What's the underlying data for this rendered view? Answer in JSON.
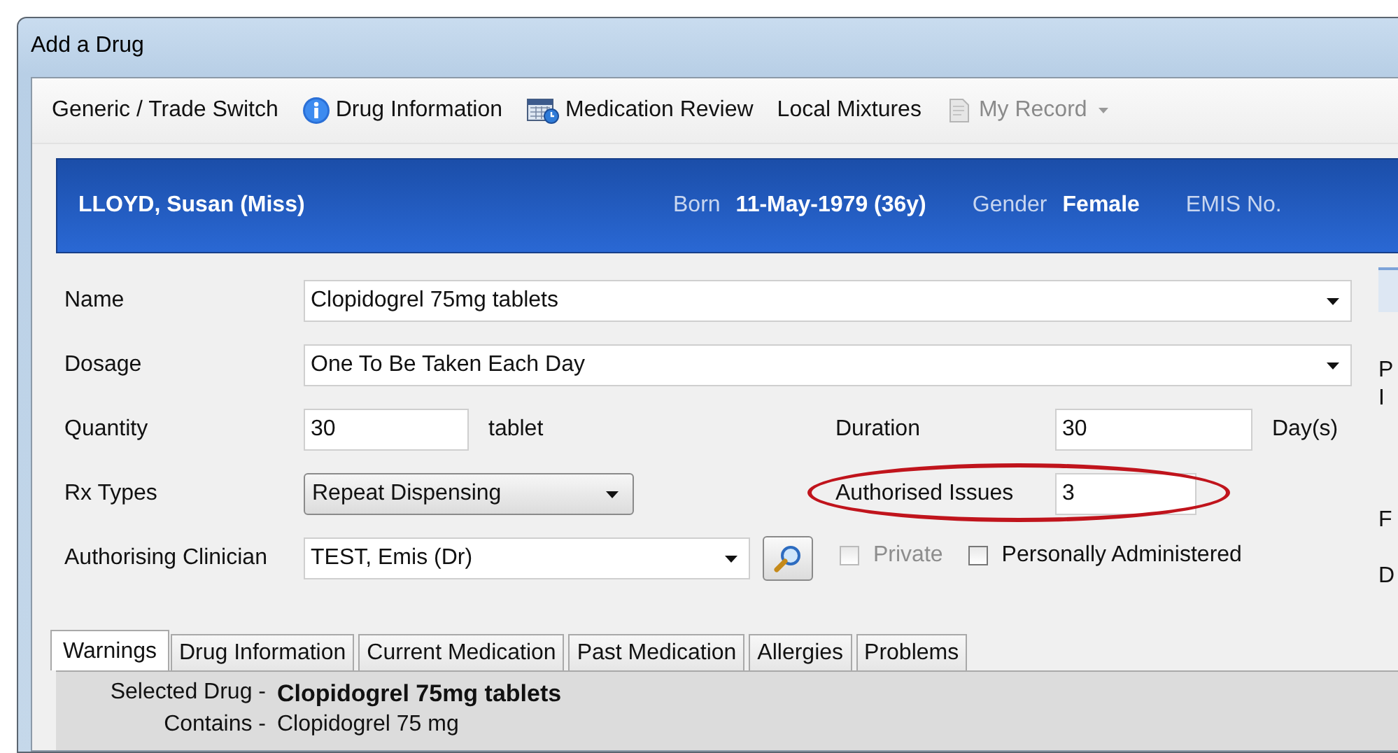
{
  "window": {
    "title": "Add a Drug"
  },
  "toolbar": [
    {
      "label": "Generic / Trade Switch",
      "kind": "plain",
      "disabled": false
    },
    {
      "label": "Drug Information",
      "kind": "info",
      "disabled": false
    },
    {
      "label": "Medication Review",
      "kind": "calendar",
      "disabled": false
    },
    {
      "label": "Local Mixtures",
      "kind": "plain",
      "disabled": false
    },
    {
      "label": "My Record",
      "kind": "record-menu",
      "disabled": true
    }
  ],
  "patient": {
    "name": "LLOYD, Susan (Miss)",
    "fields": [
      {
        "label": "Born",
        "value": "11-May-1979 (36y)"
      },
      {
        "label": "Gender",
        "value": "Female"
      },
      {
        "label": "EMIS No."
      }
    ]
  },
  "form": {
    "name": {
      "label": "Name",
      "value": "Clopidogrel 75mg tablets"
    },
    "dosage": {
      "label": "Dosage",
      "value": "One To Be Taken Each Day"
    },
    "quantity": {
      "label": "Quantity",
      "value": "30",
      "unit": "tablet"
    },
    "duration": {
      "label": "Duration",
      "value": "30",
      "unit": "Day(s)"
    },
    "rx_types": {
      "label": "Rx Types",
      "value": "Repeat Dispensing"
    },
    "authorised_issues": {
      "label": "Authorised Issues",
      "value": "3",
      "highlighted": true
    },
    "clinician": {
      "label": "Authorising Clinician",
      "value": "TEST, Emis (Dr)"
    },
    "checkboxes": [
      {
        "label": "Private",
        "checked": false,
        "disabled": true
      },
      {
        "label": "Personally Administered",
        "checked": false,
        "disabled": false
      }
    ]
  },
  "side_panel": {
    "letters": [
      "P",
      "I",
      "F",
      "D"
    ]
  },
  "tabs": [
    {
      "label": "Warnings",
      "selected": true
    },
    {
      "label": "Drug Information",
      "selected": false
    },
    {
      "label": "Current Medication",
      "selected": false
    },
    {
      "label": "Past Medication",
      "selected": false
    },
    {
      "label": "Allergies",
      "selected": false
    },
    {
      "label": "Problems",
      "selected": false
    }
  ],
  "warnings": [
    {
      "label": "Selected Drug -",
      "value": "Clopidogrel 75mg tablets",
      "bold": true
    },
    {
      "label": "Contains -",
      "value": "Clopidogrel 75 mg",
      "bold": false
    }
  ]
}
